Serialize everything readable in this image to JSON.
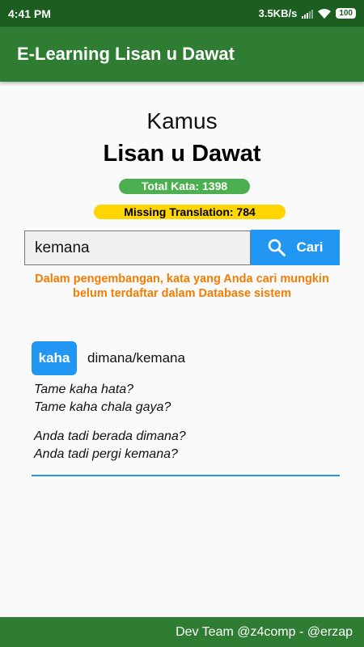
{
  "status_bar": {
    "time": "4:41 PM",
    "network_speed": "3.5KB/s",
    "battery": "100"
  },
  "app_bar": {
    "title": "E-Learning Lisan u Dawat"
  },
  "header": {
    "subtitle": "Kamus",
    "title": "Lisan u Dawat"
  },
  "stats": {
    "total_words": "Total Kata: 1398",
    "missing_translation": "Missing Translation: 784"
  },
  "search": {
    "query": "kemana",
    "button_label": "Cari",
    "button_icon": "search-icon"
  },
  "notice": {
    "text": "Dalam pengembangan, kata yang Anda cari mungkin belum terdaftar dalam Database sistem"
  },
  "results": [
    {
      "word": "kaha",
      "meaning": "dimana/kemana",
      "examples_source": [
        "Tame kaha hata?",
        "Tame kaha chala gaya?"
      ],
      "examples_translation": [
        "Anda tadi berada dimana?",
        "Anda tadi pergi kemana?"
      ]
    }
  ],
  "footer": {
    "text": "Dev Team @z4comp - @erzap"
  },
  "colors": {
    "status_bar": "#1b5e20",
    "primary": "#2e7d32",
    "accent": "#2196f3",
    "total_badge": "#4caf50",
    "missing_badge": "#ffd600",
    "notice": "#f57c00"
  }
}
